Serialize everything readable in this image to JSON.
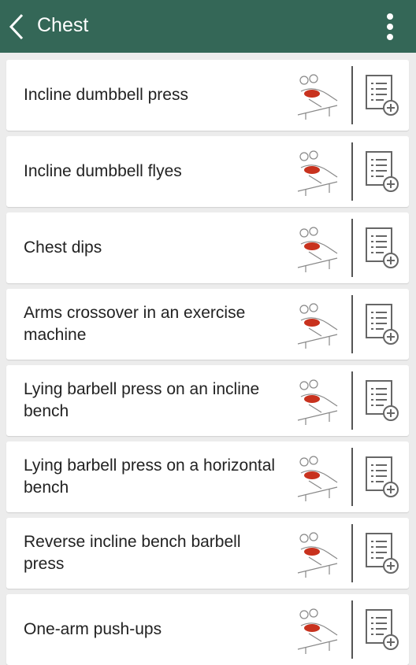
{
  "appbar": {
    "title": "Chest",
    "back_icon": "chevron-left-icon",
    "menu_icon": "more-vertical-icon",
    "color": "#346757"
  },
  "exercises": [
    {
      "name": "Incline dumbbell press"
    },
    {
      "name": "Incline dumbbell flyes"
    },
    {
      "name": "Chest dips"
    },
    {
      "name": "Arms crossover in an exercise machine"
    },
    {
      "name": "Lying barbell press on an incline bench"
    },
    {
      "name": "Lying barbell press on a horizontal bench"
    },
    {
      "name": "Reverse incline bench barbell press"
    },
    {
      "name": "One-arm push-ups"
    }
  ],
  "item_icons": {
    "thumbnail": "exercise-illustration-icon",
    "add": "add-to-workout-list-icon"
  },
  "colors": {
    "muscle_highlight": "#c8321e",
    "background": "#ececec"
  }
}
